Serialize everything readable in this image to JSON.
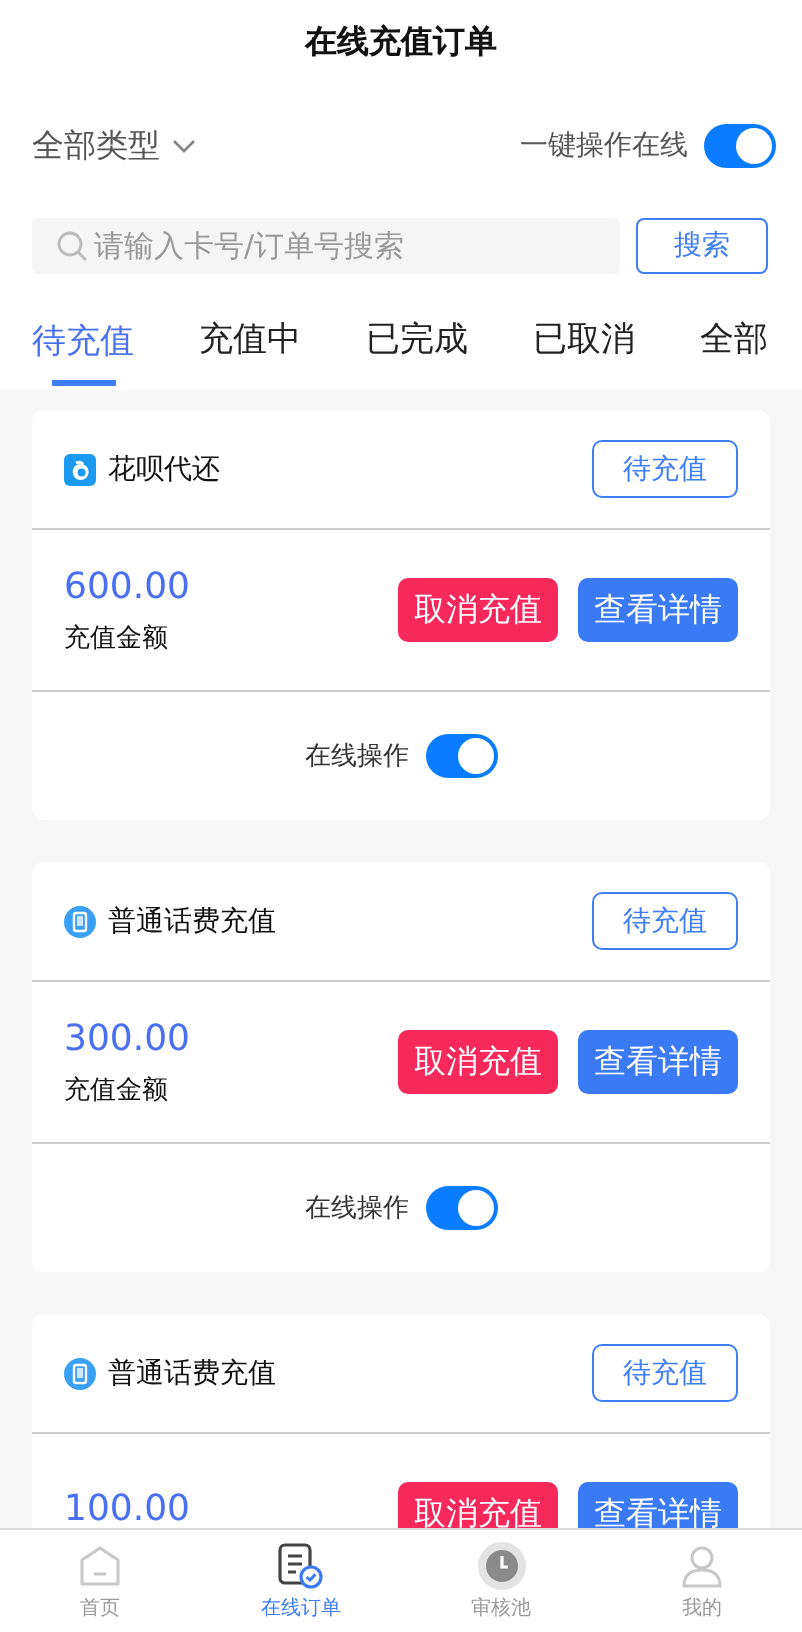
{
  "header": {
    "title": "在线充值订单"
  },
  "filter": {
    "type_label": "全部类型",
    "bulk_label": "一键操作在线",
    "bulk_on": true
  },
  "search": {
    "placeholder": "请输入卡号/订单号搜索",
    "button": "搜索"
  },
  "tabs": [
    {
      "label": "待充值",
      "selected": true
    },
    {
      "label": "充值中",
      "selected": false
    },
    {
      "label": "已完成",
      "selected": false
    },
    {
      "label": "已取消",
      "selected": false
    },
    {
      "label": "全部",
      "selected": false
    }
  ],
  "orders": [
    {
      "kind": "huabei",
      "name": "花呗代还",
      "status": "待充值",
      "amount": "600.00",
      "amount_label": "充值金额",
      "cancel": "取消充值",
      "detail": "查看详情",
      "online_label": "在线操作",
      "online_on": true
    },
    {
      "kind": "phone",
      "name": "普通话费充值",
      "status": "待充值",
      "amount": "300.00",
      "amount_label": "充值金额",
      "cancel": "取消充值",
      "detail": "查看详情",
      "online_label": "在线操作",
      "online_on": true
    },
    {
      "kind": "phone",
      "name": "普通话费充值",
      "status": "待充值",
      "amount": "100.00",
      "cancel": "取消充值",
      "detail": "查看详情"
    }
  ],
  "bottom_nav": [
    {
      "kind": "home",
      "label": "首页",
      "selected": false
    },
    {
      "kind": "orders",
      "label": "在线订单",
      "selected": true
    },
    {
      "kind": "review",
      "label": "审核池",
      "selected": false
    },
    {
      "kind": "me",
      "label": "我的",
      "selected": false
    }
  ]
}
